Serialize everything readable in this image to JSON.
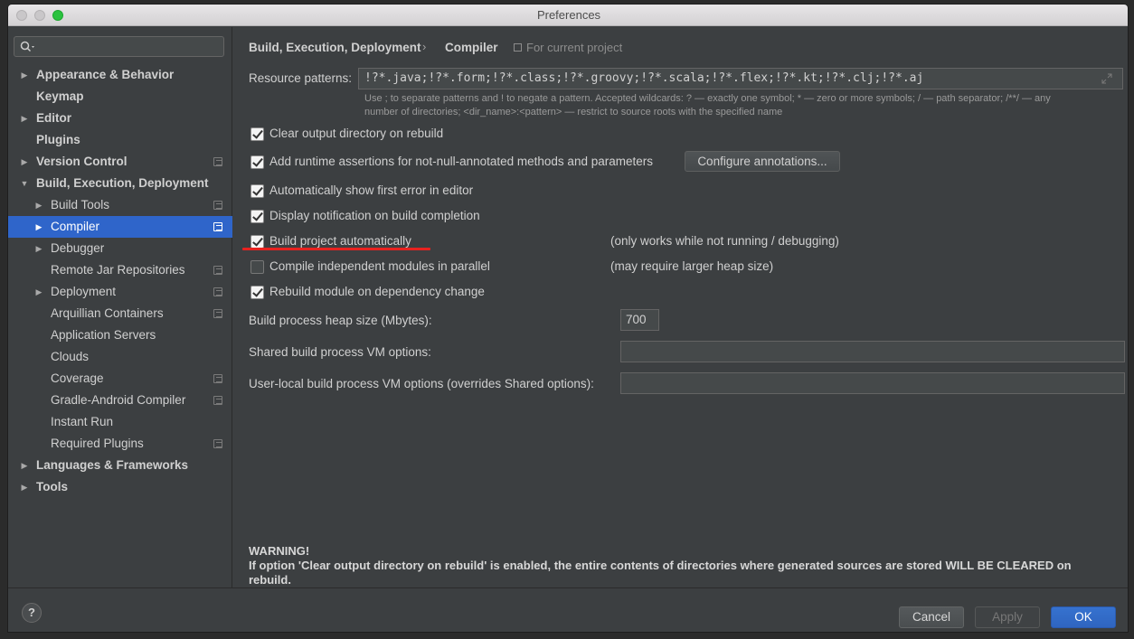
{
  "window": {
    "title": "Preferences"
  },
  "sidebar": {
    "search_placeholder": "",
    "items": [
      {
        "label": "Appearance & Behavior",
        "bold": true,
        "expand": "collapsed",
        "indent": 0,
        "project": false
      },
      {
        "label": "Keymap",
        "bold": true,
        "expand": "none",
        "indent": 0,
        "project": false
      },
      {
        "label": "Editor",
        "bold": true,
        "expand": "collapsed",
        "indent": 0,
        "project": false
      },
      {
        "label": "Plugins",
        "bold": true,
        "expand": "none",
        "indent": 0,
        "project": false
      },
      {
        "label": "Version Control",
        "bold": true,
        "expand": "collapsed",
        "indent": 0,
        "project": true
      },
      {
        "label": "Build, Execution, Deployment",
        "bold": true,
        "expand": "expanded",
        "indent": 0,
        "project": false
      },
      {
        "label": "Build Tools",
        "bold": false,
        "expand": "collapsed",
        "indent": 1,
        "project": true
      },
      {
        "label": "Compiler",
        "bold": false,
        "expand": "collapsed",
        "indent": 1,
        "project": true,
        "selected": true
      },
      {
        "label": "Debugger",
        "bold": false,
        "expand": "collapsed",
        "indent": 1,
        "project": false
      },
      {
        "label": "Remote Jar Repositories",
        "bold": false,
        "expand": "none",
        "indent": 1,
        "project": true
      },
      {
        "label": "Deployment",
        "bold": false,
        "expand": "collapsed",
        "indent": 1,
        "project": true
      },
      {
        "label": "Arquillian Containers",
        "bold": false,
        "expand": "none",
        "indent": 1,
        "project": true
      },
      {
        "label": "Application Servers",
        "bold": false,
        "expand": "none",
        "indent": 1,
        "project": false
      },
      {
        "label": "Clouds",
        "bold": false,
        "expand": "none",
        "indent": 1,
        "project": false
      },
      {
        "label": "Coverage",
        "bold": false,
        "expand": "none",
        "indent": 1,
        "project": true
      },
      {
        "label": "Gradle-Android Compiler",
        "bold": false,
        "expand": "none",
        "indent": 1,
        "project": true
      },
      {
        "label": "Instant Run",
        "bold": false,
        "expand": "none",
        "indent": 1,
        "project": false
      },
      {
        "label": "Required Plugins",
        "bold": false,
        "expand": "none",
        "indent": 1,
        "project": true
      },
      {
        "label": "Languages & Frameworks",
        "bold": true,
        "expand": "collapsed",
        "indent": 0,
        "project": false
      },
      {
        "label": "Tools",
        "bold": true,
        "expand": "collapsed",
        "indent": 0,
        "project": false
      }
    ]
  },
  "breadcrumb": {
    "parent": "Build, Execution, Deployment",
    "separator": "›",
    "current": "Compiler",
    "scope": "For current project"
  },
  "compiler": {
    "resource_label": "Resource patterns:",
    "resource_value": "!?*.java;!?*.form;!?*.class;!?*.groovy;!?*.scala;!?*.flex;!?*.kt;!?*.clj;!?*.aj",
    "hint_line1": "Use ; to separate patterns and ! to negate a pattern. Accepted wildcards: ? — exactly one symbol; * — zero or more symbols; / — path separator; /**/ — any",
    "hint_line2": "number of directories; <dir_name>:<pattern> — restrict to source roots with the specified name",
    "options": [
      {
        "label": "Clear output directory on rebuild",
        "checked": true,
        "note": ""
      },
      {
        "label": "Add runtime assertions for not-null-annotated methods and parameters",
        "checked": true,
        "note": ""
      },
      {
        "label": "Automatically show first error in editor",
        "checked": true,
        "note": ""
      },
      {
        "label": "Display notification on build completion",
        "checked": true,
        "note": ""
      },
      {
        "label": "Build project automatically",
        "checked": true,
        "note": "(only works while not running / debugging)"
      },
      {
        "label": "Compile independent modules in parallel",
        "checked": false,
        "note": "(may require larger heap size)"
      },
      {
        "label": "Rebuild module on dependency change",
        "checked": true,
        "note": ""
      }
    ],
    "configure_button": "Configure annotations...",
    "heap_label": "Build process heap size (Mbytes):",
    "heap_value": "700",
    "shared_vm_label": "Shared build process VM options:",
    "shared_vm_value": "",
    "local_vm_label": "User-local build process VM options (overrides Shared options):",
    "local_vm_value": "",
    "warning_title": "WARNING!",
    "warning_text": "If option 'Clear output directory on rebuild' is enabled, the entire contents of directories where generated sources are stored WILL BE CLEARED on rebuild."
  },
  "footer": {
    "help": "?",
    "cancel": "Cancel",
    "apply": "Apply",
    "ok": "OK"
  },
  "colors": {
    "selection": "#2f65ca",
    "annotation_underline": "#e8221f",
    "ok_button": "#3672cf"
  }
}
